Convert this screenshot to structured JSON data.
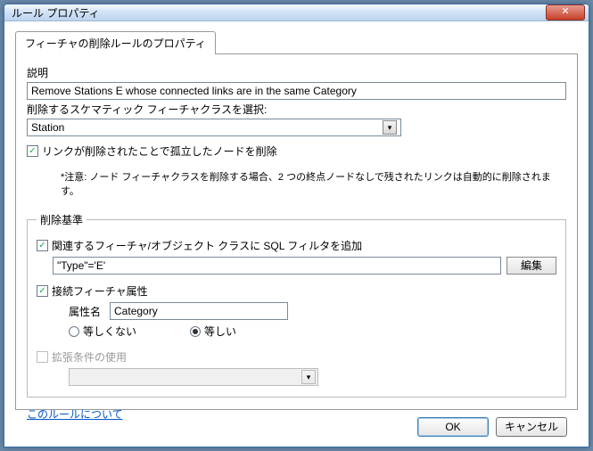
{
  "window": {
    "title": "ルール プロパティ"
  },
  "tab": {
    "label": "フィーチャの削除ルールのプロパティ"
  },
  "description": {
    "label": "説明",
    "value": "Remove Stations E whose connected links are in the same Category"
  },
  "featureClass": {
    "label": "削除するスケマティック フィーチャクラスを選択:",
    "selected": "Station"
  },
  "removeOrphan": {
    "checked": true,
    "label": "リンクが削除されたことで孤立したノードを削除"
  },
  "note": "*注意: ノード フィーチャクラスを削除する場合、2 つの終点ノードなしで残されたリンクは自動的に削除されます。",
  "criteria": {
    "legend": "削除基準",
    "sqlFilter": {
      "checked": true,
      "label": "関連するフィーチャ/オブジェクト クラスに SQL フィルタを追加",
      "value": "\"Type\"='E'",
      "editButton": "編集"
    },
    "connectedAttr": {
      "checked": true,
      "label": "接続フィーチャ属性",
      "attrNameLabel": "属性名",
      "attrNameValue": "Category",
      "radioNotEqual": "等しくない",
      "radioEqual": "等しい",
      "equalSelected": true
    },
    "extended": {
      "checked": false,
      "label": "拡張条件の使用"
    }
  },
  "link": "このルールについて",
  "buttons": {
    "ok": "OK",
    "cancel": "キャンセル"
  }
}
